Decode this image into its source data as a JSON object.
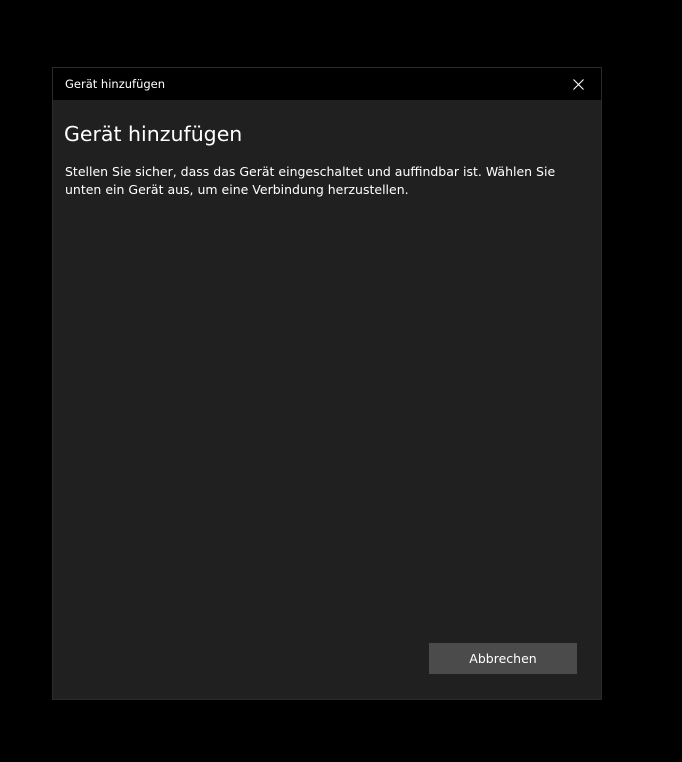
{
  "window": {
    "title": "Gerät hinzufügen"
  },
  "dialog": {
    "heading": "Gerät hinzufügen",
    "description": "Stellen Sie sicher, dass das Gerät eingeschaltet und auffindbar ist. Wählen Sie unten ein Gerät aus, um eine Verbindung herzustellen.",
    "cancel_label": "Abbrechen"
  },
  "icons": {
    "close": "close-icon"
  },
  "colors": {
    "background": "#000000",
    "dialog_background": "#202020",
    "titlebar_background": "#000000",
    "button_background": "#4b4b4b",
    "text": "#ffffff"
  }
}
